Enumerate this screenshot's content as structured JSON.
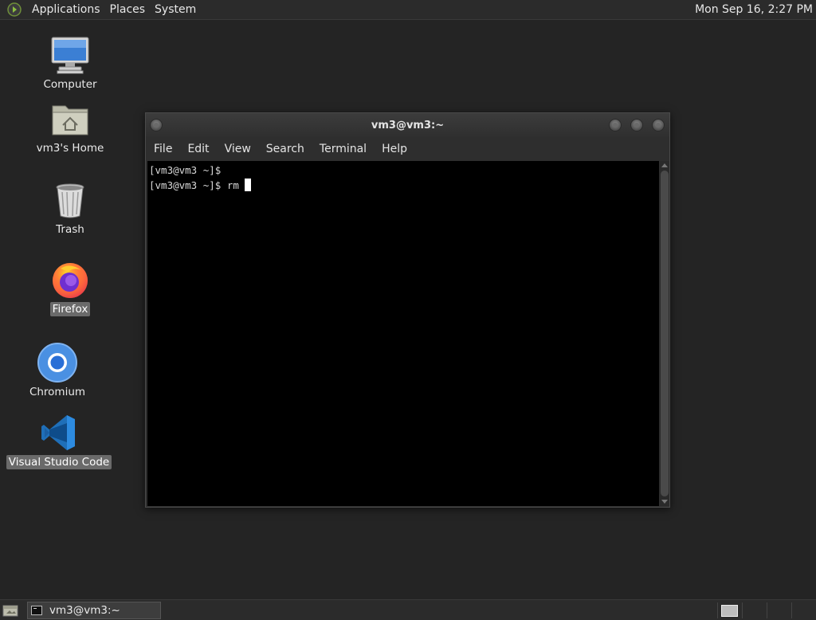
{
  "top_panel": {
    "menus": [
      "Applications",
      "Places",
      "System"
    ],
    "clock": "Mon Sep 16,  2:27 PM",
    "logo_icon": "gnome-foot-icon"
  },
  "desktop_icons": [
    {
      "label": "Computer",
      "icon": "computer-icon"
    },
    {
      "label": "vm3's Home",
      "icon": "home-folder-icon"
    },
    {
      "label": "Trash",
      "icon": "trash-icon"
    },
    {
      "label": "Firefox",
      "icon": "firefox-icon"
    },
    {
      "label": "Chromium",
      "icon": "chromium-icon"
    },
    {
      "label": "Visual Studio Code",
      "icon": "vscode-icon"
    }
  ],
  "terminal": {
    "title": "vm3@vm3:~",
    "menus": [
      "File",
      "Edit",
      "View",
      "Search",
      "Terminal",
      "Help"
    ],
    "lines": [
      "[vm3@vm3 ~]$",
      "[vm3@vm3 ~]$ rm"
    ]
  },
  "bottom_panel": {
    "task_label": "vm3@vm3:~",
    "workspaces": 4,
    "active_workspace": 1
  },
  "colors": {
    "desktop_bg": "#242424",
    "panel_bg": "#2b2b2b",
    "terminal_bg": "#000000",
    "selected_label_bg": "#6a6a6a"
  }
}
